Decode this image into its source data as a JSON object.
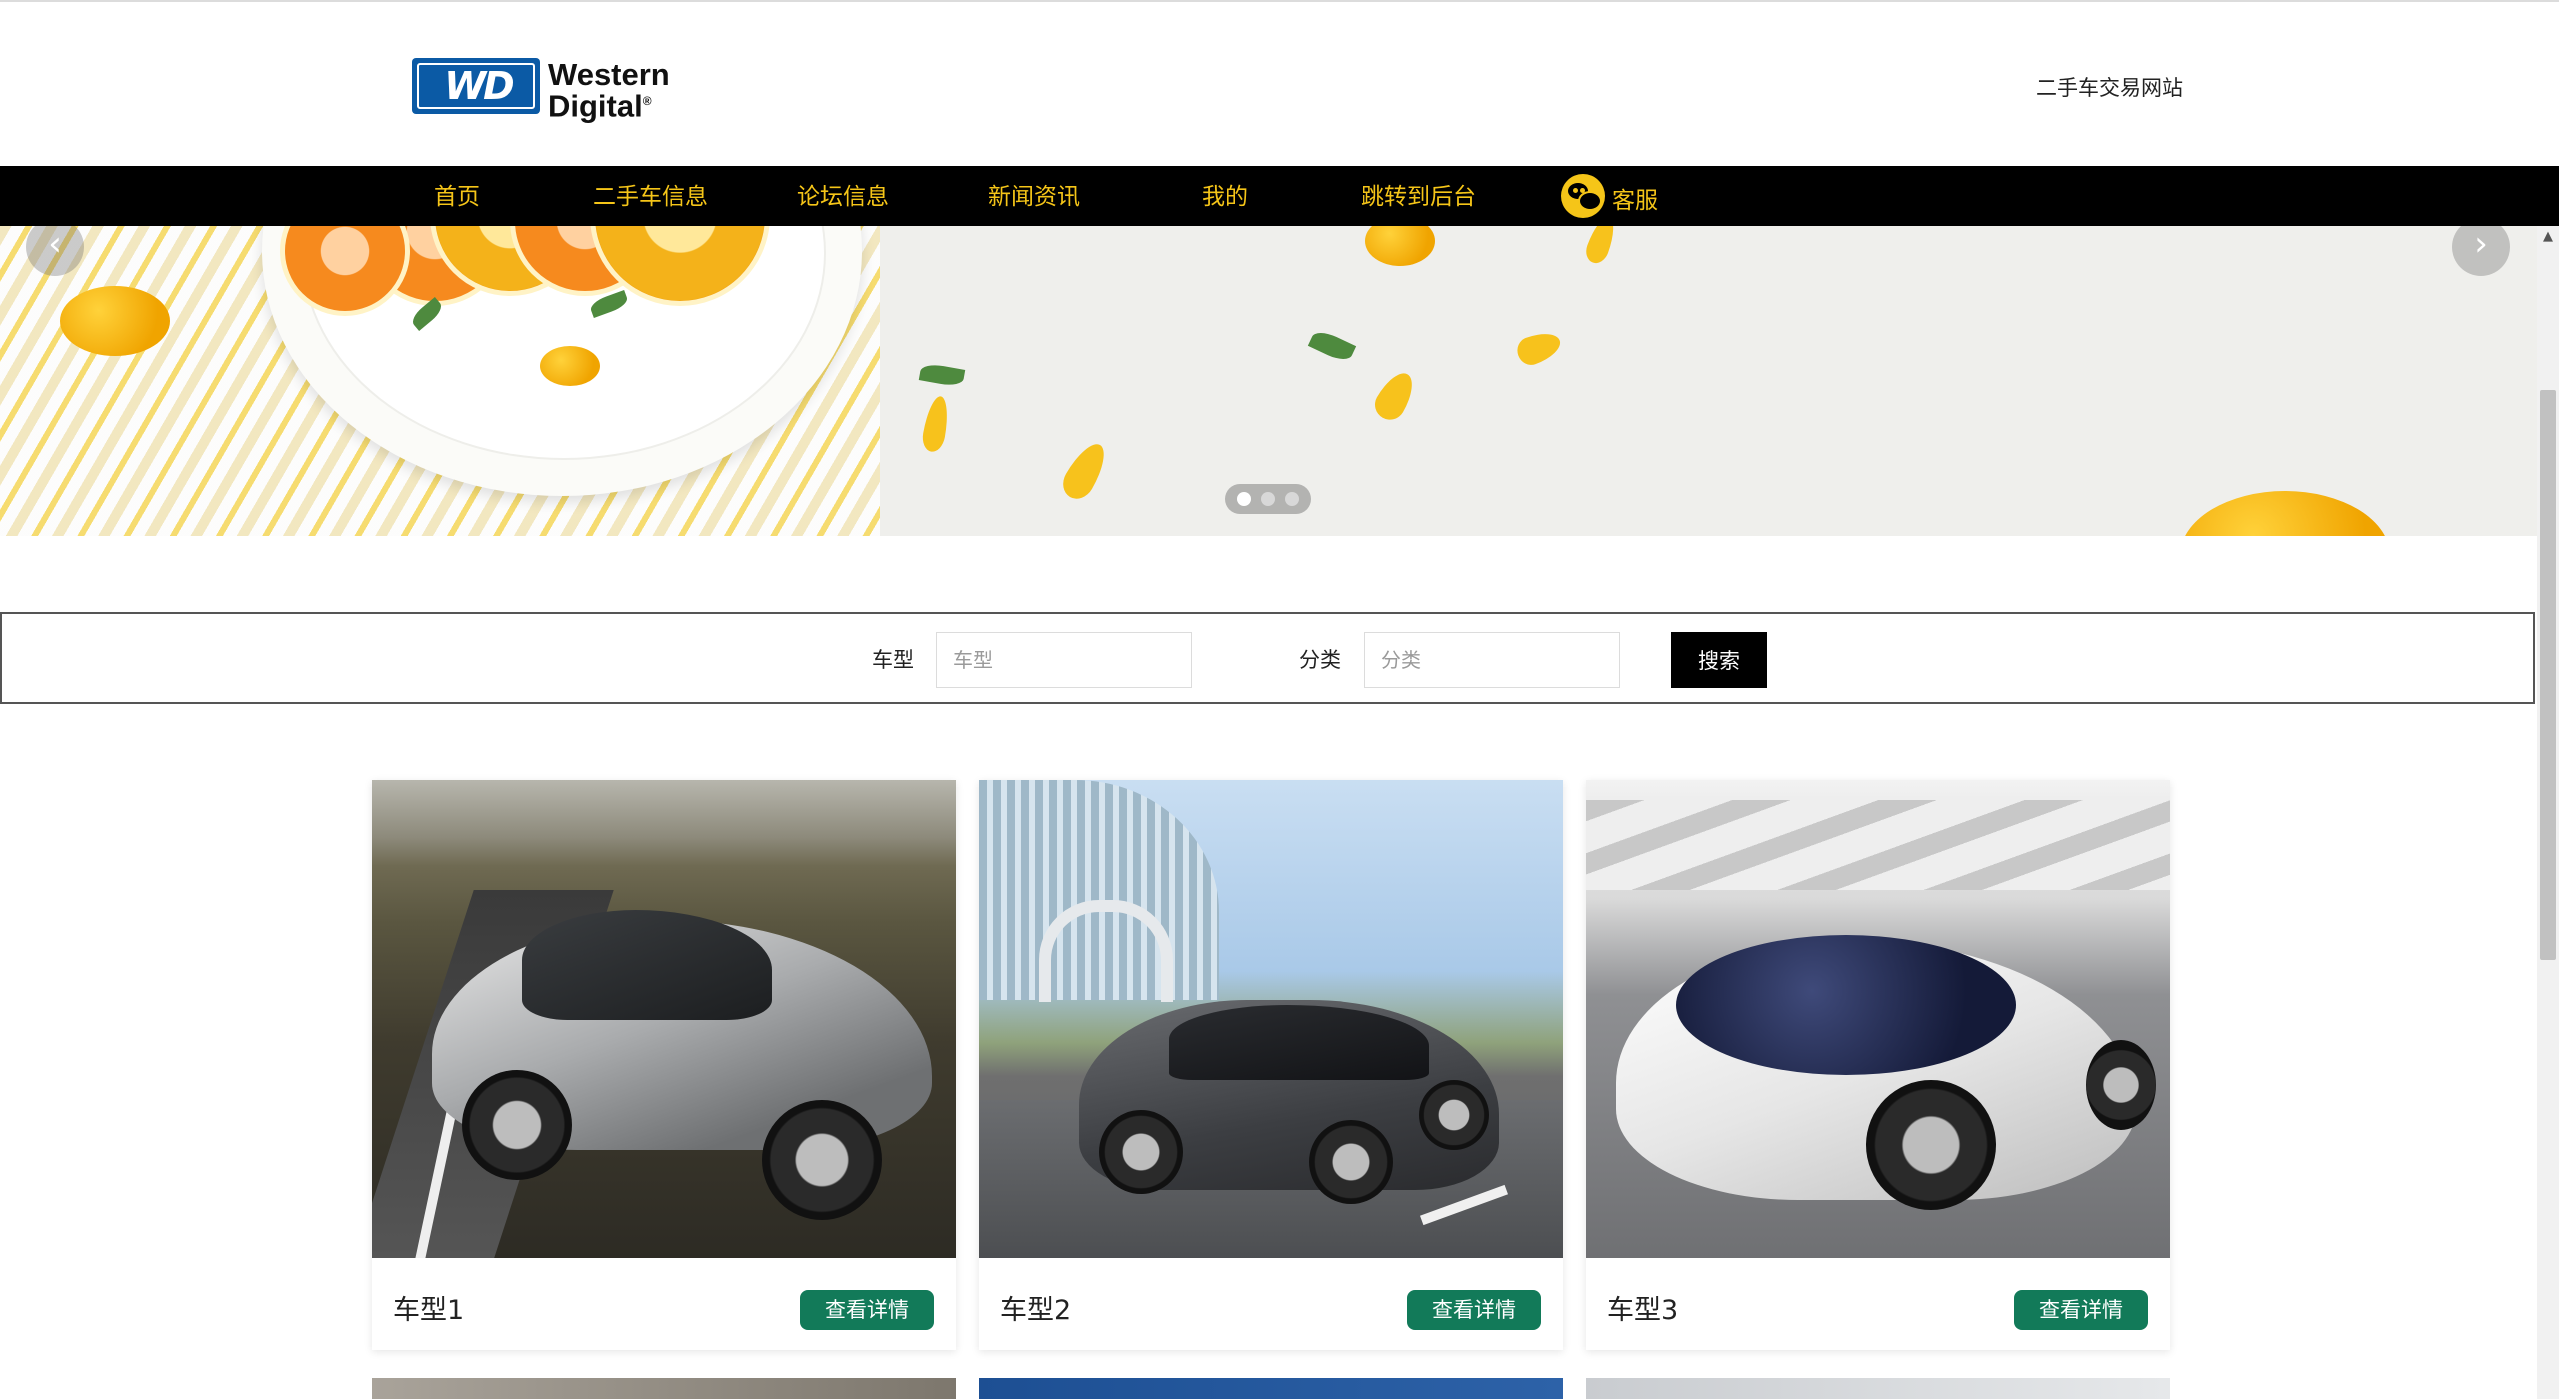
{
  "header": {
    "logo_mark": "WD",
    "logo_line1": "Western",
    "logo_line2": "Digital",
    "logo_registered": "®",
    "site_title": "二手车交易网站"
  },
  "nav": {
    "items": [
      {
        "label": "首页"
      },
      {
        "label": "二手车信息"
      },
      {
        "label": "论坛信息"
      },
      {
        "label": "新闻资讯"
      },
      {
        "label": "我的"
      },
      {
        "label": "跳转到后台"
      },
      {
        "label": "客服"
      }
    ]
  },
  "banner": {
    "prev_arrow": "‹",
    "next_arrow": "›",
    "slide_count": 3,
    "active_slide": 1
  },
  "search": {
    "field1_label": "车型",
    "field1_placeholder": "车型",
    "field2_label": "分类",
    "field2_placeholder": "分类",
    "button_label": "搜索"
  },
  "cards": [
    {
      "name": "车型1",
      "button_label": "查看详情"
    },
    {
      "name": "车型2",
      "button_label": "查看详情"
    },
    {
      "name": "车型3",
      "button_label": "查看详情"
    }
  ],
  "colors": {
    "nav_bg": "#000000",
    "nav_text": "#f5c518",
    "accent_button": "#127a59",
    "logo_blue": "#0b5aa5"
  },
  "icons": {
    "chat": "wechat-icon",
    "prev": "chevron-left-icon",
    "next": "chevron-right-icon"
  }
}
